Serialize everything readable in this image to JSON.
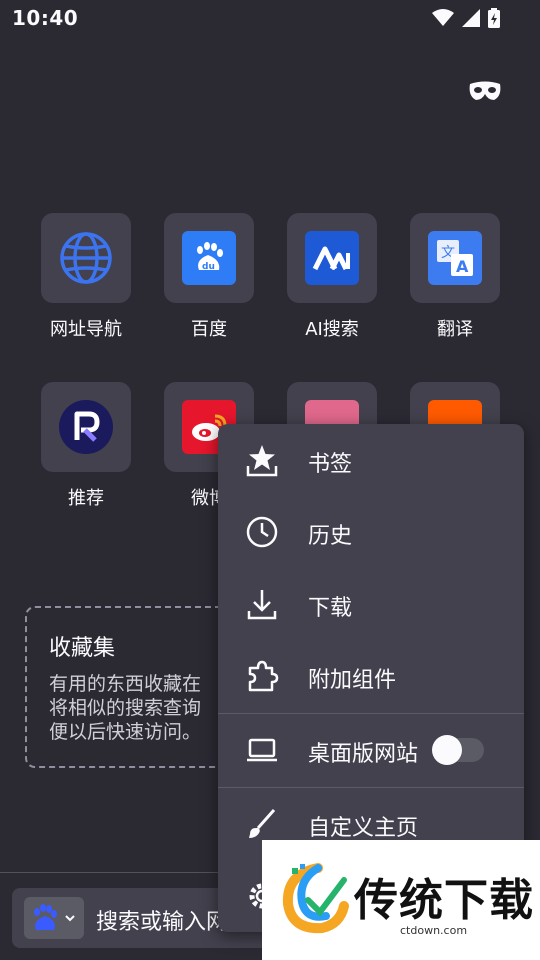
{
  "status_bar": {
    "time": "10:40"
  },
  "shortcuts": [
    {
      "label": "网址导航",
      "icon": "globe-icon"
    },
    {
      "label": "百度",
      "icon": "baidu-icon",
      "color": "#2e7cf6"
    },
    {
      "label": "AI搜索",
      "icon": "ai-search-icon",
      "color": "#1f5ad6"
    },
    {
      "label": "翻译",
      "icon": "translate-icon",
      "color": "#3d7cf0"
    },
    {
      "label": "推荐",
      "icon": "recommend-icon",
      "color": "#1a1a5c"
    },
    {
      "label": "微博",
      "icon": "weibo-icon",
      "color": "#e6162d"
    }
  ],
  "collections": {
    "title": "收藏集",
    "body": "有用的东西收藏在\n将相似的搜索查询\n便以后快速访问。"
  },
  "search_bar": {
    "placeholder": "搜索或输入网"
  },
  "menu": {
    "items": [
      {
        "label": "书签",
        "icon": "bookmark-star-icon"
      },
      {
        "label": "历史",
        "icon": "history-clock-icon"
      },
      {
        "label": "下载",
        "icon": "download-icon"
      },
      {
        "label": "附加组件",
        "icon": "addons-puzzle-icon"
      },
      {
        "label": "桌面版网站",
        "icon": "desktop-laptop-icon",
        "toggle": false
      },
      {
        "label": "自定义主页",
        "icon": "paintbrush-icon"
      }
    ]
  },
  "watermark": {
    "name": "传统下载",
    "url": "ctdown.com"
  },
  "colors": {
    "background": "#2b2a33",
    "tile": "#42414d",
    "menu": "#42414d"
  }
}
